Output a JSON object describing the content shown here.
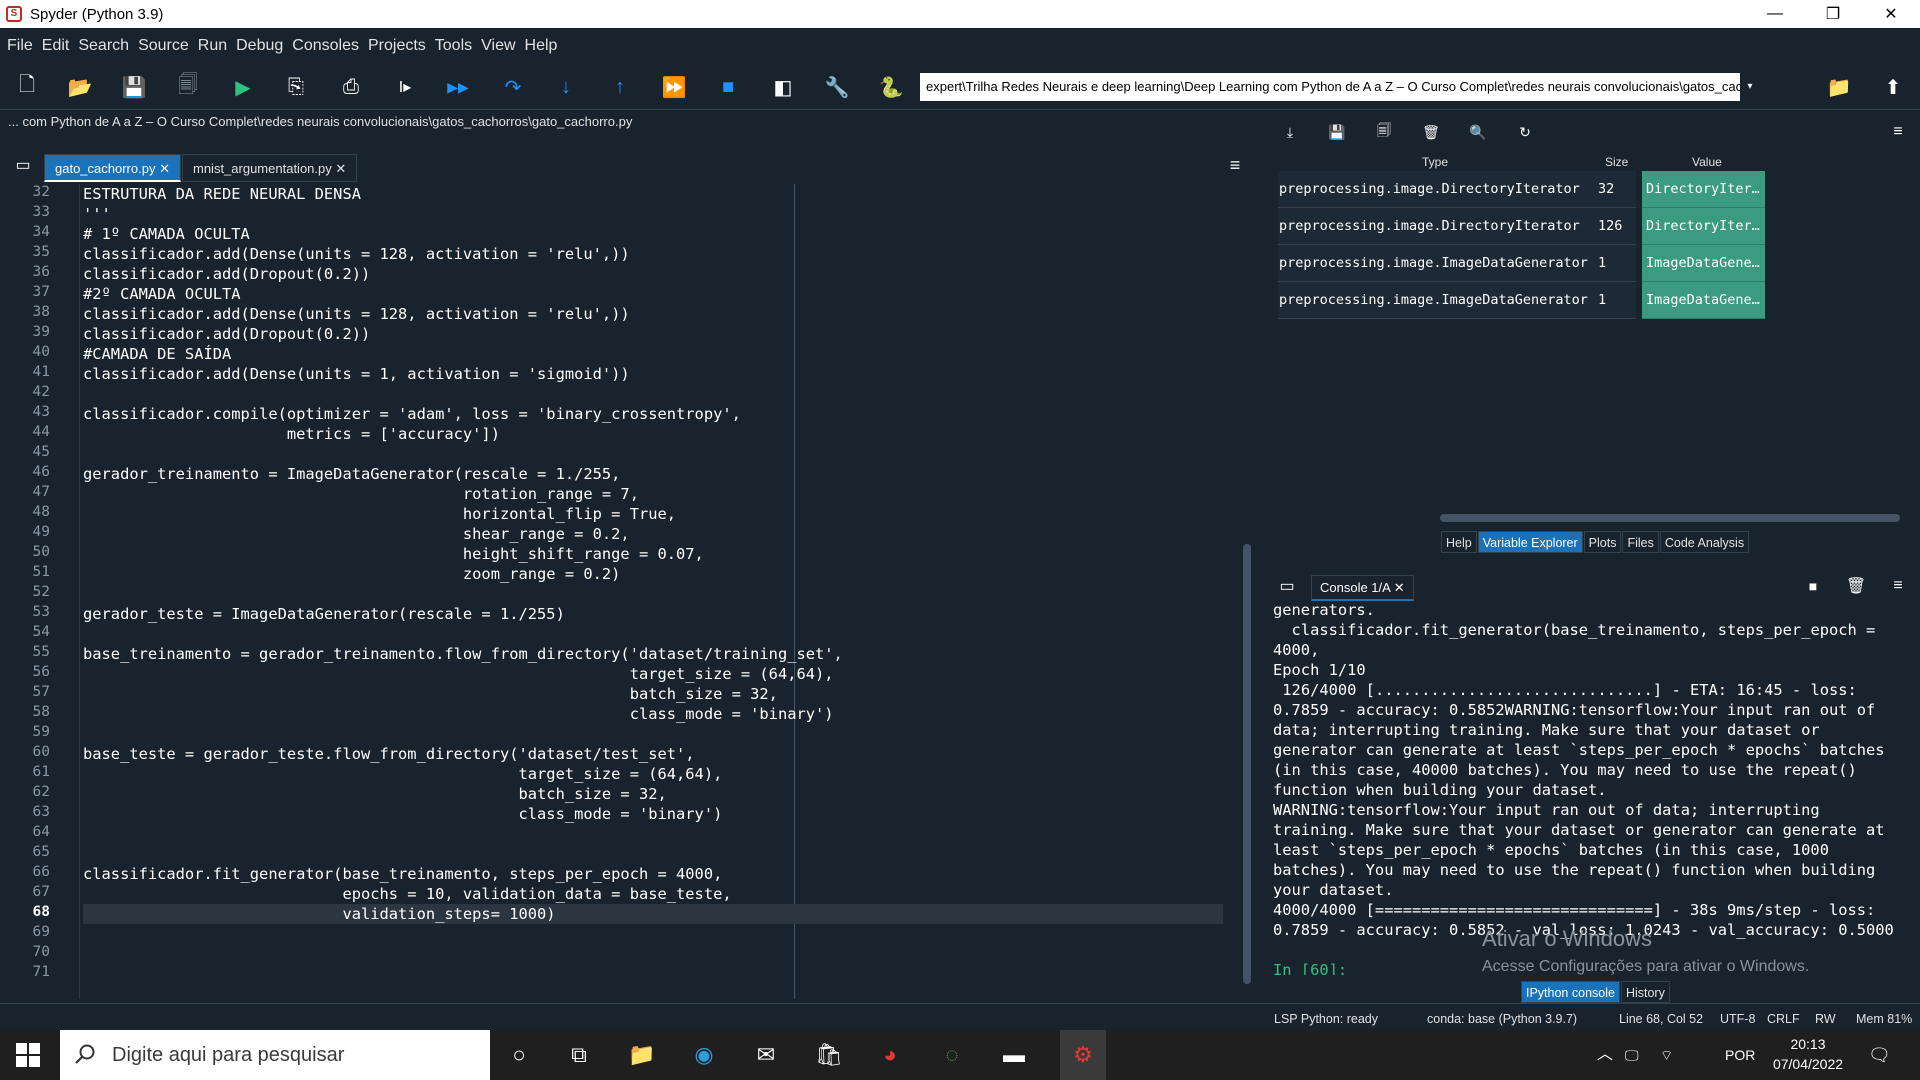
{
  "window": {
    "title": "Spyder (Python 3.9)",
    "controls": [
      "—",
      "❐",
      "✕"
    ]
  },
  "menu": [
    "File",
    "Edit",
    "Search",
    "Source",
    "Run",
    "Debug",
    "Consoles",
    "Projects",
    "Tools",
    "View",
    "Help"
  ],
  "toolbar": {
    "icons": [
      {
        "name": "new-file-icon",
        "glyph": "🗋"
      },
      {
        "name": "open-file-icon",
        "glyph": "📂"
      },
      {
        "name": "save-icon",
        "glyph": "💾"
      },
      {
        "name": "save-all-icon",
        "glyph": "🗐"
      },
      {
        "name": "run-icon",
        "glyph": "▶"
      },
      {
        "name": "run-cell-icon",
        "glyph": "⎘"
      },
      {
        "name": "run-cell-advance-icon",
        "glyph": "⎙"
      },
      {
        "name": "run-selection-icon",
        "glyph": "I▸"
      },
      {
        "name": "debug-icon",
        "glyph": "▶▶"
      },
      {
        "name": "step-icon",
        "glyph": "↷"
      },
      {
        "name": "step-into-icon",
        "glyph": "↓"
      },
      {
        "name": "step-return-icon",
        "glyph": "↑"
      },
      {
        "name": "continue-icon",
        "glyph": "⏩"
      },
      {
        "name": "stop-icon",
        "glyph": "■"
      },
      {
        "name": "maximize-pane-icon",
        "glyph": "◧"
      },
      {
        "name": "preferences-icon",
        "glyph": "🔧"
      },
      {
        "name": "python-path-icon",
        "glyph": "🐍"
      }
    ],
    "working_dir": "expert\\Trilha Redes Neurais e deep learning\\Deep Learning com Python de A a Z – O Curso Complet\\redes neurais convolucionais\\gatos_cachorros"
  },
  "editor": {
    "filepath": "... com Python de A a Z – O Curso Complet\\redes neurais convolucionais\\gatos_cachorros\\gato_cachorro.py",
    "tabs": [
      {
        "label": "gato_cachorro.py",
        "active": true
      },
      {
        "label": "mnist_argumentation.py",
        "active": false
      }
    ],
    "lines": [
      {
        "n": "32",
        "text": "ESTRUTURA DA REDE NEURAL DENSA"
      },
      {
        "n": "33",
        "text": "'''"
      },
      {
        "n": "34",
        "text": "# 1º CAMADA OCULTA"
      },
      {
        "n": "35",
        "text": "classificador.add(Dense(units = 128, activation = 'relu',))"
      },
      {
        "n": "36",
        "text": "classificador.add(Dropout(0.2))"
      },
      {
        "n": "37",
        "text": "#2º CAMADA OCULTA"
      },
      {
        "n": "38",
        "text": "classificador.add(Dense(units = 128, activation = 'relu',))"
      },
      {
        "n": "39",
        "text": "classificador.add(Dropout(0.2))"
      },
      {
        "n": "40",
        "text": "#CAMADA DE SAÍDA"
      },
      {
        "n": "41",
        "text": "classificador.add(Dense(units = 1, activation = 'sigmoid'))"
      },
      {
        "n": "42",
        "text": ""
      },
      {
        "n": "43",
        "text": "classificador.compile(optimizer = 'adam', loss = 'binary_crossentropy',"
      },
      {
        "n": "44",
        "text": "                      metrics = ['accuracy'])"
      },
      {
        "n": "45",
        "text": ""
      },
      {
        "n": "46",
        "text": "gerador_treinamento = ImageDataGenerator(rescale = 1./255,"
      },
      {
        "n": "47",
        "text": "                                         rotation_range = 7,"
      },
      {
        "n": "48",
        "text": "                                         horizontal_flip = True,"
      },
      {
        "n": "49",
        "text": "                                         shear_range = 0.2,"
      },
      {
        "n": "50",
        "text": "                                         height_shift_range = 0.07,"
      },
      {
        "n": "51",
        "text": "                                         zoom_range = 0.2)"
      },
      {
        "n": "52",
        "text": ""
      },
      {
        "n": "53",
        "text": "gerador_teste = ImageDataGenerator(rescale = 1./255)"
      },
      {
        "n": "54",
        "text": ""
      },
      {
        "n": "55",
        "text": "base_treinamento = gerador_treinamento.flow_from_directory('dataset/training_set',"
      },
      {
        "n": "56",
        "text": "                                                           target_size = (64,64),"
      },
      {
        "n": "57",
        "text": "                                                           batch_size = 32,"
      },
      {
        "n": "58",
        "text": "                                                           class_mode = 'binary')"
      },
      {
        "n": "59",
        "text": ""
      },
      {
        "n": "60",
        "text": "base_teste = gerador_teste.flow_from_directory('dataset/test_set',"
      },
      {
        "n": "61",
        "text": "                                               target_size = (64,64),"
      },
      {
        "n": "62",
        "text": "                                               batch_size = 32,"
      },
      {
        "n": "63",
        "text": "                                               class_mode = 'binary')"
      },
      {
        "n": "64",
        "text": ""
      },
      {
        "n": "65",
        "text": ""
      },
      {
        "n": "66",
        "text": "classificador.fit_generator(base_treinamento, steps_per_epoch = 4000,"
      },
      {
        "n": "67",
        "text": "                            epochs = 10, validation_data = base_teste,"
      },
      {
        "n": "68",
        "text": "                            validation_steps= 1000)"
      },
      {
        "n": "69",
        "text": ""
      },
      {
        "n": "70",
        "text": ""
      },
      {
        "n": "71",
        "text": ""
      }
    ],
    "current_line": "68"
  },
  "variable_explorer": {
    "headers": [
      "Type",
      "Size",
      "Value"
    ],
    "rows": [
      {
        "type": "preprocessing.image.DirectoryIterator",
        "size": "32",
        "value": "DirectoryIter…"
      },
      {
        "type": "preprocessing.image.DirectoryIterator",
        "size": "126",
        "value": "DirectoryIter…"
      },
      {
        "type": "preprocessing.image.ImageDataGenerator",
        "size": "1",
        "value": "ImageDataGene…"
      },
      {
        "type": "preprocessing.image.ImageDataGenerator",
        "size": "1",
        "value": "ImageDataGene…"
      }
    ],
    "pane_tabs": [
      "Help",
      "Variable Explorer",
      "Plots",
      "Files",
      "Code Analysis"
    ],
    "active_tab": "Variable Explorer"
  },
  "console": {
    "tab_label": "Console 1/A",
    "output": "generators.\n  classificador.fit_generator(base_treinamento, steps_per_epoch = 4000,\nEpoch 1/10\n 126/4000 [..............................] - ETA: 16:45 - loss: 0.7859 - accuracy: 0.5852WARNING:tensorflow:Your input ran out of data; interrupting training. Make sure that your dataset or generator can generate at least `steps_per_epoch * epochs` batches (in this case, 40000 batches). You may need to use the repeat() function when building your dataset.\nWARNING:tensorflow:Your input ran out of data; interrupting training. Make sure that your dataset or generator can generate at least `steps_per_epoch * epochs` batches (in this case, 1000 batches). You may need to use the repeat() function when building your dataset.\n4000/4000 [==============================] - 38s 9ms/step - loss: 0.7859 - accuracy: 0.5852 - val_loss: 1.0243 - val_accuracy: 0.5000",
    "prompt": "In [60]:",
    "bottom_tabs": [
      "IPython console",
      "History"
    ],
    "active_bottom_tab": "IPython console"
  },
  "watermark": {
    "line1": "Ativar o Windows",
    "line2": "Acesse Configurações para ativar o Windows."
  },
  "statusbar": {
    "lsp": "LSP Python: ready",
    "conda": "conda: base (Python 3.9.7)",
    "position": "Line 68, Col 52",
    "encoding": "UTF-8",
    "eol": "CRLF",
    "rw": "RW",
    "mem": "Mem 81%"
  },
  "taskbar": {
    "search_placeholder": "Digite aqui para pesquisar",
    "lang": "POR",
    "time": "20:13",
    "date": "07/04/2022"
  }
}
